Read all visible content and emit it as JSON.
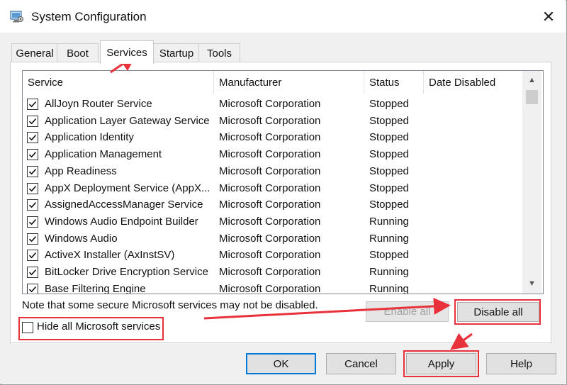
{
  "window": {
    "title": "System Configuration",
    "app_icon": "msconfig-icon",
    "close_glyph": "✕"
  },
  "tabs": [
    {
      "label": "General",
      "active": false
    },
    {
      "label": "Boot",
      "active": false
    },
    {
      "label": "Services",
      "active": true
    },
    {
      "label": "Startup",
      "active": false
    },
    {
      "label": "Tools",
      "active": false
    }
  ],
  "services_table": {
    "columns": [
      "Service",
      "Manufacturer",
      "Status",
      "Date Disabled"
    ],
    "rows": [
      {
        "service": "AllJoyn Router Service",
        "manufacturer": "Microsoft Corporation",
        "status": "Stopped",
        "date_disabled": "",
        "checked": true
      },
      {
        "service": "Application Layer Gateway Service",
        "manufacturer": "Microsoft Corporation",
        "status": "Stopped",
        "date_disabled": "",
        "checked": true
      },
      {
        "service": "Application Identity",
        "manufacturer": "Microsoft Corporation",
        "status": "Stopped",
        "date_disabled": "",
        "checked": true
      },
      {
        "service": "Application Management",
        "manufacturer": "Microsoft Corporation",
        "status": "Stopped",
        "date_disabled": "",
        "checked": true
      },
      {
        "service": "App Readiness",
        "manufacturer": "Microsoft Corporation",
        "status": "Stopped",
        "date_disabled": "",
        "checked": true
      },
      {
        "service": "AppX Deployment Service (AppX...",
        "manufacturer": "Microsoft Corporation",
        "status": "Stopped",
        "date_disabled": "",
        "checked": true
      },
      {
        "service": "AssignedAccessManager Service",
        "manufacturer": "Microsoft Corporation",
        "status": "Stopped",
        "date_disabled": "",
        "checked": true
      },
      {
        "service": "Windows Audio Endpoint Builder",
        "manufacturer": "Microsoft Corporation",
        "status": "Running",
        "date_disabled": "",
        "checked": true
      },
      {
        "service": "Windows Audio",
        "manufacturer": "Microsoft Corporation",
        "status": "Running",
        "date_disabled": "",
        "checked": true
      },
      {
        "service": "ActiveX Installer (AxInstSV)",
        "manufacturer": "Microsoft Corporation",
        "status": "Stopped",
        "date_disabled": "",
        "checked": true
      },
      {
        "service": "BitLocker Drive Encryption Service",
        "manufacturer": "Microsoft Corporation",
        "status": "Running",
        "date_disabled": "",
        "checked": true
      },
      {
        "service": "Base Filtering Engine",
        "manufacturer": "Microsoft Corporation",
        "status": "Running",
        "date_disabled": "",
        "checked": true
      }
    ]
  },
  "note": "Note that some secure Microsoft services may not be disabled.",
  "buttons": {
    "enable_all": "Enable all",
    "disable_all": "Disable all",
    "ok": "OK",
    "cancel": "Cancel",
    "apply": "Apply",
    "help": "Help"
  },
  "hide_ms_services": {
    "label": "Hide all Microsoft services",
    "checked": false
  },
  "colors": {
    "annotation_red": "#e8313a",
    "focus_blue": "#0078d7"
  }
}
